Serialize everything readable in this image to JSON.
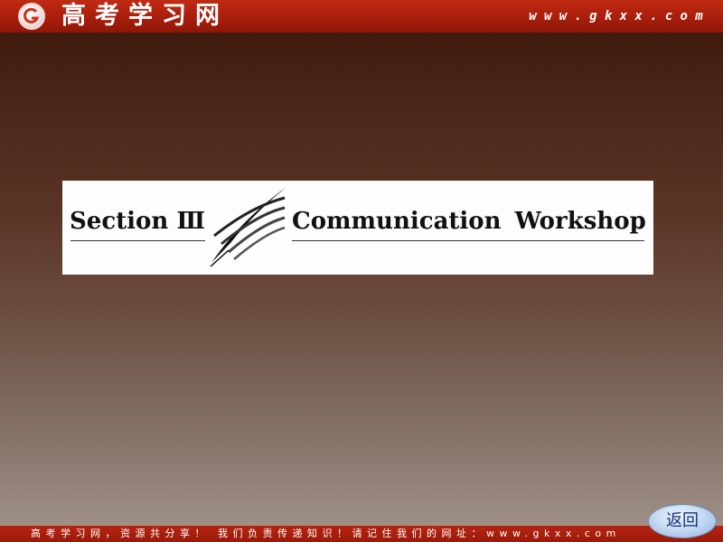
{
  "header": {
    "logo_text": "高考学习网",
    "site_url": "www.gkxx.com"
  },
  "title_card": {
    "section_label": "Section Ⅲ",
    "title": "Communication Workshop"
  },
  "footer": {
    "text": "高考学习网，资源共分享！ 我们负责传递知识！请记住我们的网址：www.gkxx.com"
  },
  "back_button": {
    "label": "返回"
  }
}
